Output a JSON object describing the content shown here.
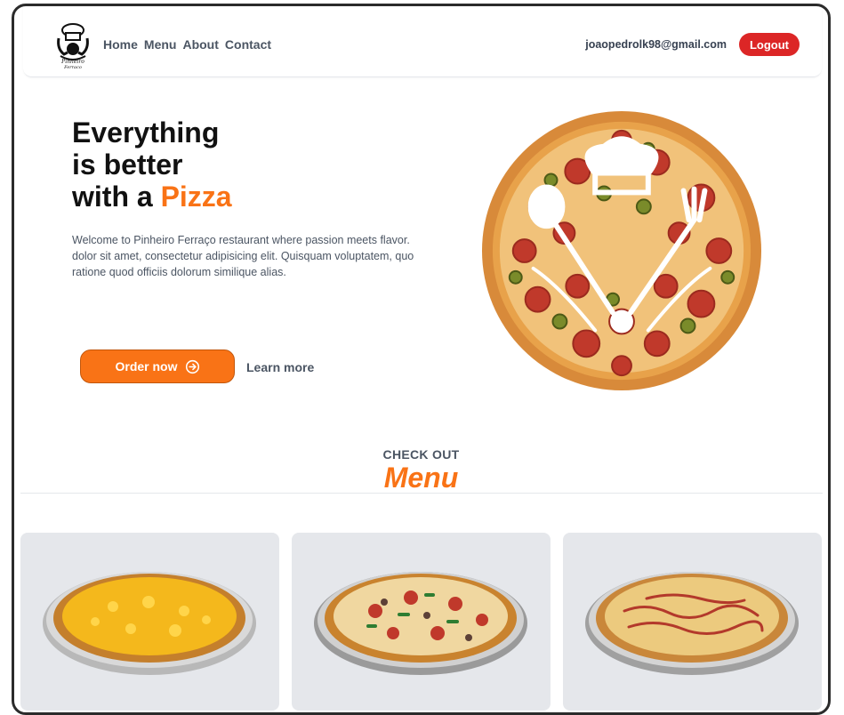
{
  "nav": {
    "brand_text": "Pinheiro Ferraço",
    "links": [
      "Home",
      "Menu",
      "About",
      "Contact"
    ],
    "user_email": "joaopedrolk98@gmail.com",
    "logout_label": "Logout"
  },
  "hero": {
    "title_line1": "Everything",
    "title_line2": "is better",
    "title_line3_prefix": "with a ",
    "title_accent": "Pizza",
    "description": "Welcome to Pinheiro Ferraço restaurant where passion meets flavor. dolor sit amet, consectetur adipisicing elit. Quisquam voluptatem, quo ratione quod officiis dolorum similique alias.",
    "order_label": "Order now",
    "learn_more_label": "Learn more"
  },
  "menu_section": {
    "eyebrow": "CHECK OUT",
    "title": "Menu",
    "cards": [
      {
        "image": "mac-and-cheese-pizza"
      },
      {
        "image": "supreme-pizza"
      },
      {
        "image": "cheese-sauce-pizza"
      }
    ]
  },
  "colors": {
    "accent": "#f97316",
    "logout": "#dc2626",
    "card_bg": "#e5e7eb"
  },
  "icons": {
    "logo": "chef-hat-utensils-logo",
    "order_arrow": "arrow-right-circle-icon"
  }
}
